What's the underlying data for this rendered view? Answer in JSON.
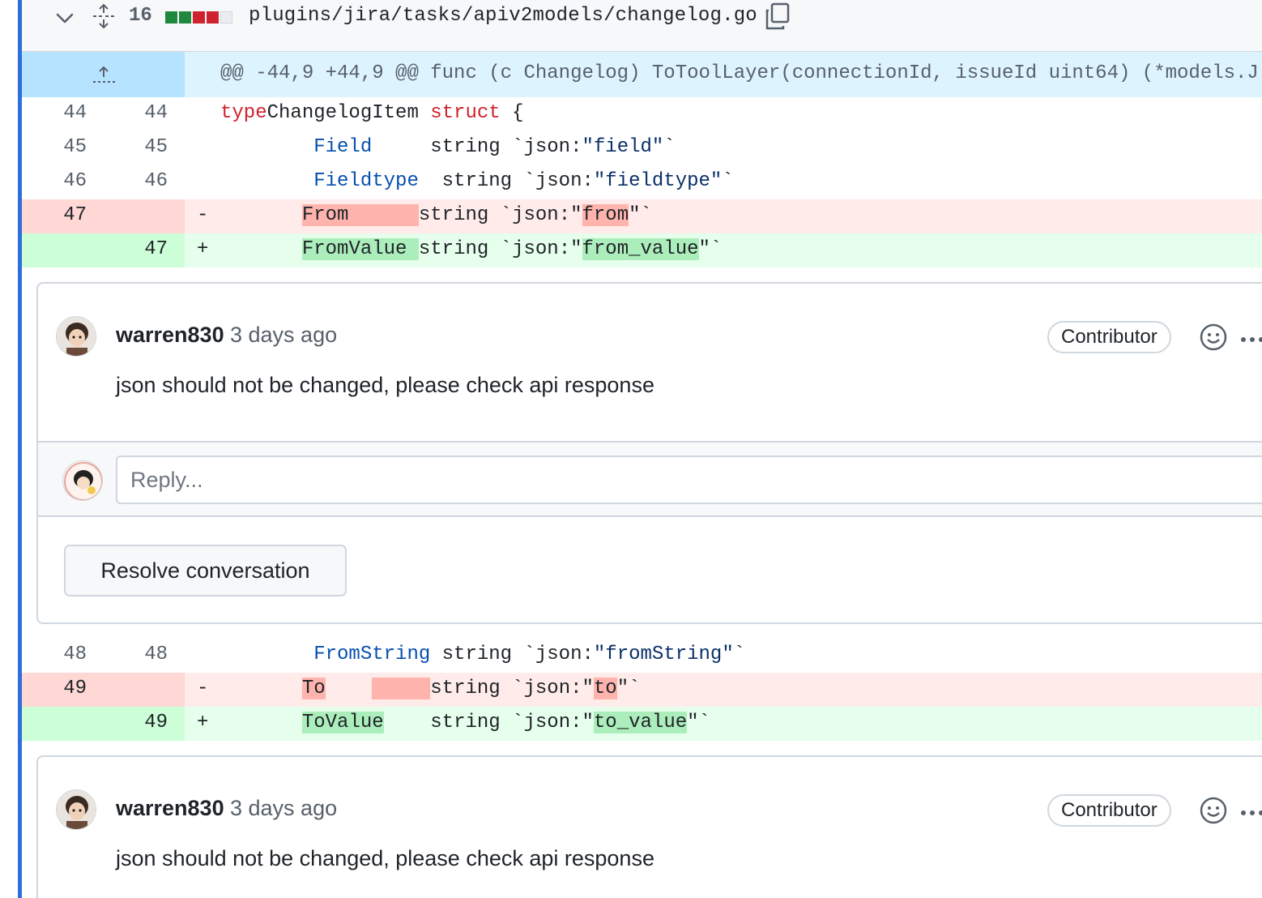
{
  "file": {
    "changes_count": "16",
    "diffstat": [
      "add",
      "add",
      "del",
      "del",
      "neu"
    ],
    "path": "plugins/jira/tasks/apiv2models/changelog.go"
  },
  "hunk": {
    "header": "@@ -44,9 +44,9 @@ func (c Changelog) ToToolLayer(connectionId, issueId uint64) (*models.J"
  },
  "lines": [
    {
      "type": "ctx",
      "old": "44",
      "new": "44",
      "marker": "",
      "tokens": [
        [
          "kw",
          "type"
        ],
        [
          "",
          "ChangelogItem "
        ],
        [
          "kw",
          "struct"
        ],
        [
          "",
          " {"
        ]
      ]
    },
    {
      "type": "ctx",
      "old": "45",
      "new": "45",
      "marker": "",
      "tokens": [
        [
          "",
          "        "
        ],
        [
          "fld",
          "Field"
        ],
        [
          "",
          "     string `json:"
        ],
        [
          "str",
          "\"field\""
        ],
        [
          "",
          "`"
        ]
      ]
    },
    {
      "type": "ctx",
      "old": "46",
      "new": "46",
      "marker": "",
      "tokens": [
        [
          "",
          "        "
        ],
        [
          "fld",
          "Fieldtype"
        ],
        [
          "",
          "  string `json:"
        ],
        [
          "str",
          "\"fieldtype\""
        ],
        [
          "",
          "`"
        ]
      ]
    },
    {
      "type": "del",
      "old": "47",
      "new": "",
      "marker": "-",
      "tokens": [
        [
          "",
          "       "
        ],
        [
          "hl-del",
          "From      "
        ],
        [
          "",
          "string `json:\""
        ],
        [
          "hl-del",
          "from"
        ],
        [
          "",
          "\"`"
        ]
      ]
    },
    {
      "type": "add",
      "old": "",
      "new": "47",
      "marker": "+",
      "tokens": [
        [
          "",
          "       "
        ],
        [
          "hl-add",
          "FromValue "
        ],
        [
          "",
          "string `json:\""
        ],
        [
          "hl-add",
          "from_value"
        ],
        [
          "",
          "\"`"
        ]
      ]
    }
  ],
  "lines2": [
    {
      "type": "ctx",
      "old": "48",
      "new": "48",
      "marker": "",
      "tokens": [
        [
          "",
          "        "
        ],
        [
          "fld",
          "FromString"
        ],
        [
          "",
          " string `json:"
        ],
        [
          "str",
          "\"fromString\""
        ],
        [
          "",
          "`"
        ]
      ]
    },
    {
      "type": "del",
      "old": "49",
      "new": "",
      "marker": "-",
      "tokens": [
        [
          "",
          "       "
        ],
        [
          "hl-del",
          "To"
        ],
        [
          "",
          "    "
        ],
        [
          "hl-del",
          "     "
        ],
        [
          "",
          "string `json:\""
        ],
        [
          "hl-del",
          "to"
        ],
        [
          "",
          "\"`"
        ]
      ]
    },
    {
      "type": "add",
      "old": "",
      "new": "49",
      "marker": "+",
      "tokens": [
        [
          "",
          "       "
        ],
        [
          "hl-add",
          "ToValue"
        ],
        [
          "",
          "    string `json:\""
        ],
        [
          "hl-add",
          "to_value"
        ],
        [
          "",
          "\"`"
        ]
      ]
    }
  ],
  "thread1": {
    "author": "warren830",
    "time": "3 days ago",
    "role": "Contributor",
    "body": "json should not be changed, please check api response",
    "reply_placeholder": "Reply...",
    "resolve_label": "Resolve conversation"
  },
  "thread2": {
    "author": "warren830",
    "time": "3 days ago",
    "role": "Contributor",
    "body": "json should not be changed, please check api response"
  }
}
